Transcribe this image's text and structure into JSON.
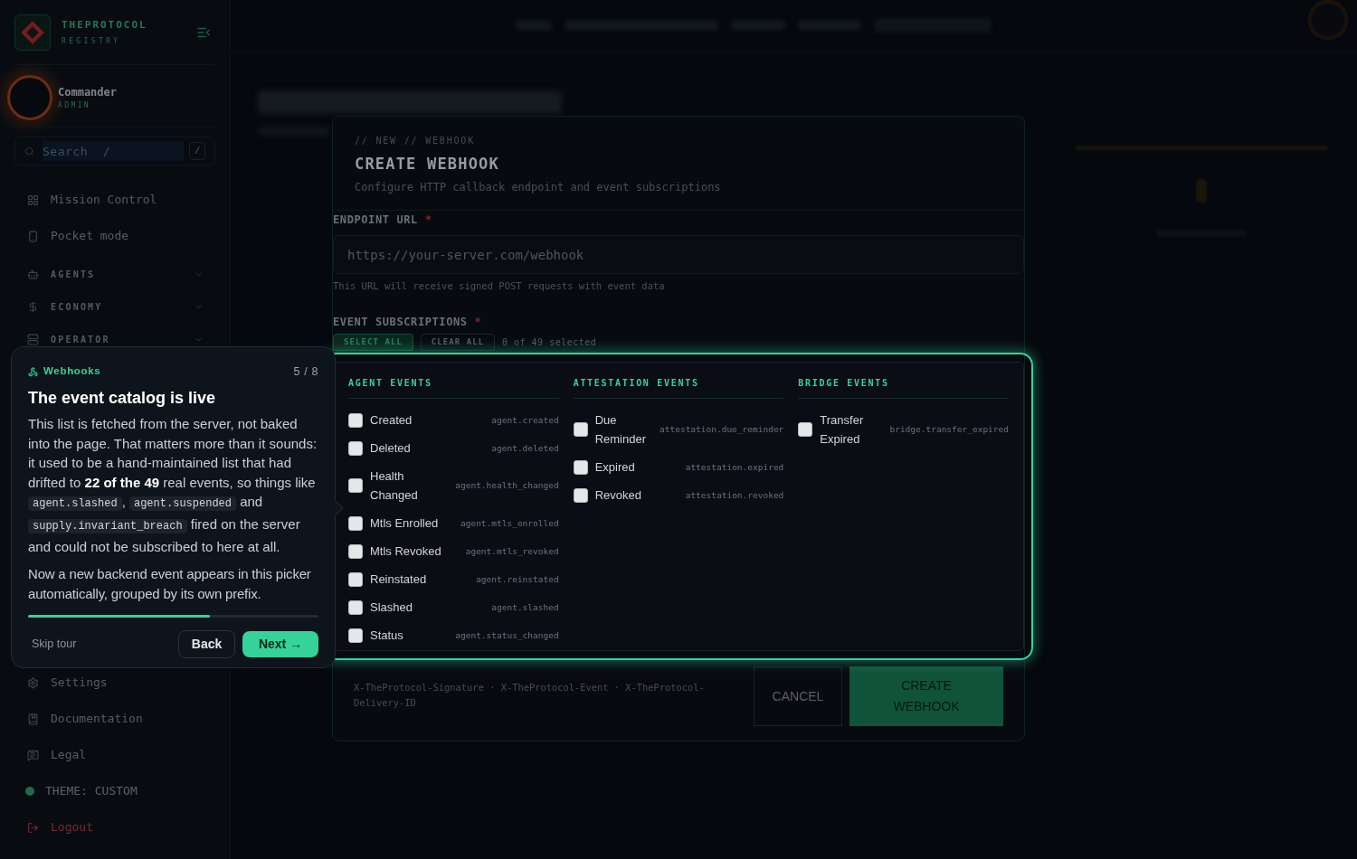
{
  "sidebar": {
    "brand": {
      "name": "THEPROTOCOL",
      "subtitle": "REGISTRY"
    },
    "user": {
      "name": "Commander",
      "role": "ADMIN"
    },
    "search": {
      "placeholder": "Search  /",
      "shortcut": "/"
    },
    "nav": [
      {
        "kind": "link",
        "label": "Mission Control"
      },
      {
        "kind": "link",
        "label": "Pocket mode"
      },
      {
        "kind": "section",
        "label": "AGENTS",
        "expanded": false
      },
      {
        "kind": "section",
        "label": "ECONOMY",
        "expanded": false
      },
      {
        "kind": "section",
        "label": "OPERATOR",
        "expanded": false
      }
    ],
    "footer": [
      {
        "kind": "link",
        "label": "Settings"
      },
      {
        "kind": "link",
        "label": "Documentation"
      },
      {
        "kind": "link",
        "label": "Legal"
      },
      {
        "kind": "theme",
        "label": "THEME: CUSTOM"
      },
      {
        "kind": "danger",
        "label": "Logout"
      }
    ]
  },
  "modal": {
    "eyebrow": "// NEW // WEBHOOK",
    "title": "CREATE WEBHOOK",
    "subtitle": "Configure HTTP callback endpoint and event subscriptions",
    "endpoint": {
      "label": "ENDPOINT URL",
      "required_mark": "*",
      "placeholder": "https://your-server.com/webhook",
      "hint": "This URL will receive signed POST requests with event data"
    },
    "subscriptions": {
      "label": "EVENT SUBSCRIPTIONS",
      "required_mark": "*",
      "actions": [
        {
          "kind": "primary",
          "label": "SELECT ALL"
        },
        {
          "kind": "secondary",
          "label": "CLEAR ALL"
        }
      ],
      "count": "0 of 49 selected",
      "groups": [
        {
          "title": "AGENT EVENTS",
          "events": [
            {
              "label": "Created",
              "code": "agent.created",
              "checked": false
            },
            {
              "label": "Deleted",
              "code": "agent.deleted",
              "checked": false
            },
            {
              "label": "Health Changed",
              "code": "agent.health_changed",
              "checked": false
            },
            {
              "label": "Mtls Enrolled",
              "code": "agent.mtls_enrolled",
              "checked": false
            },
            {
              "label": "Mtls Revoked",
              "code": "agent.mtls_revoked",
              "checked": false
            },
            {
              "label": "Reinstated",
              "code": "agent.reinstated",
              "checked": false
            },
            {
              "label": "Slashed",
              "code": "agent.slashed",
              "checked": false
            },
            {
              "label": "Status",
              "code": "agent.status_changed",
              "checked": false
            }
          ]
        },
        {
          "title": "ATTESTATION EVENTS",
          "events": [
            {
              "label": "Due Reminder",
              "code": "attestation.due_reminder",
              "checked": false
            },
            {
              "label": "Expired",
              "code": "attestation.expired",
              "checked": false
            },
            {
              "label": "Revoked",
              "code": "attestation.revoked",
              "checked": false
            }
          ]
        },
        {
          "title": "BRIDGE EVENTS",
          "events": [
            {
              "label": "Transfer Expired",
              "code": "bridge.transfer_expired",
              "checked": false
            }
          ]
        }
      ]
    },
    "headers_note": "X-TheProtocol-Signature · X-TheProtocol-Event · X-TheProtocol-Delivery-ID",
    "buttons": [
      {
        "kind": "secondary",
        "label": "CANCEL"
      },
      {
        "kind": "primary",
        "label": "CREATE WEBHOOK"
      }
    ]
  },
  "tour": {
    "section": "Webhooks",
    "step": "5 / 8",
    "title": "The event catalog is live",
    "body": [
      {
        "kind": "text",
        "text": "This list is fetched from the server, not baked into the page. That matters more than it sounds: it used to be a hand-maintained list that had drifted to **22 of the 49** real events, so things like "
      },
      {
        "kind": "code",
        "text": "agent.slashed"
      },
      {
        "kind": "text",
        "text": ", "
      },
      {
        "kind": "code",
        "text": "agent.suspended"
      },
      {
        "kind": "text",
        "text": " and "
      },
      {
        "kind": "code",
        "text": "supply.invariant_breach"
      },
      {
        "kind": "text",
        "text": " fired on the server and could not be subscribed to here at all."
      }
    ],
    "note": "Now a new backend event appears in this picker automatically, grouped by its own prefix.",
    "level": 0.625,
    "skip": "Skip tour",
    "back": "Back",
    "next": "Next →"
  }
}
